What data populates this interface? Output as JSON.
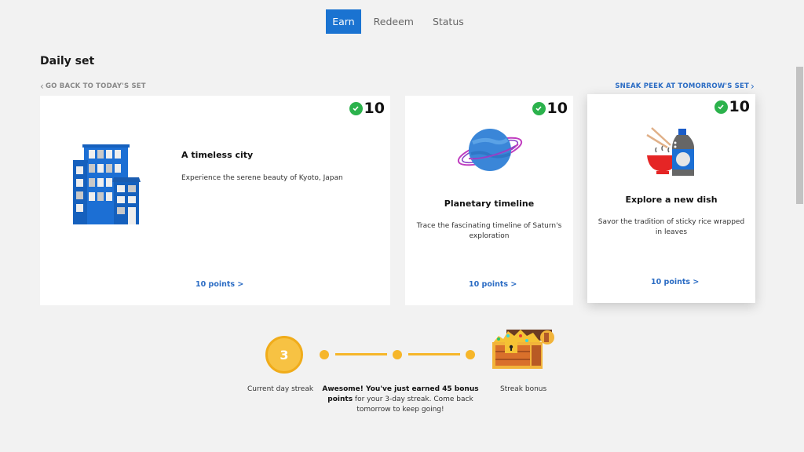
{
  "nav": {
    "tabs": [
      {
        "label": "Earn",
        "active": true
      },
      {
        "label": "Redeem",
        "active": false
      },
      {
        "label": "Status",
        "active": false
      }
    ]
  },
  "daily_set": {
    "title": "Daily set",
    "back_link": "GO BACK TO TODAY'S SET",
    "peek_link": "SNEAK PEEK AT TOMORROW'S SET",
    "cards": [
      {
        "icon": "building-icon",
        "title": "A timeless city",
        "description": "Experience the serene beauty of Kyoto, Japan",
        "points_link": "10 points >",
        "badge_points": "10",
        "completed": true
      },
      {
        "icon": "planet-icon",
        "title": "Planetary timeline",
        "description": "Trace the fascinating timeline of Saturn's exploration",
        "points_link": "10 points >",
        "badge_points": "10",
        "completed": true
      },
      {
        "icon": "food-drink-icon",
        "title": "Explore a new dish",
        "description": "Savor the tradition of sticky rice wrapped in leaves",
        "points_link": "10 points >",
        "badge_points": "10",
        "completed": true
      }
    ]
  },
  "streak": {
    "current_day": "3",
    "current_label": "Current day streak",
    "message_bold": "Awesome! You've just earned 45 bonus points",
    "message_rest": " for your 3-day streak. Come back tomorrow to keep going!",
    "bonus_label": "Streak bonus"
  },
  "colors": {
    "accent": "#1a73d1",
    "link": "#2b6cc4",
    "success": "#2bb24c",
    "streak": "#f6b62a"
  }
}
